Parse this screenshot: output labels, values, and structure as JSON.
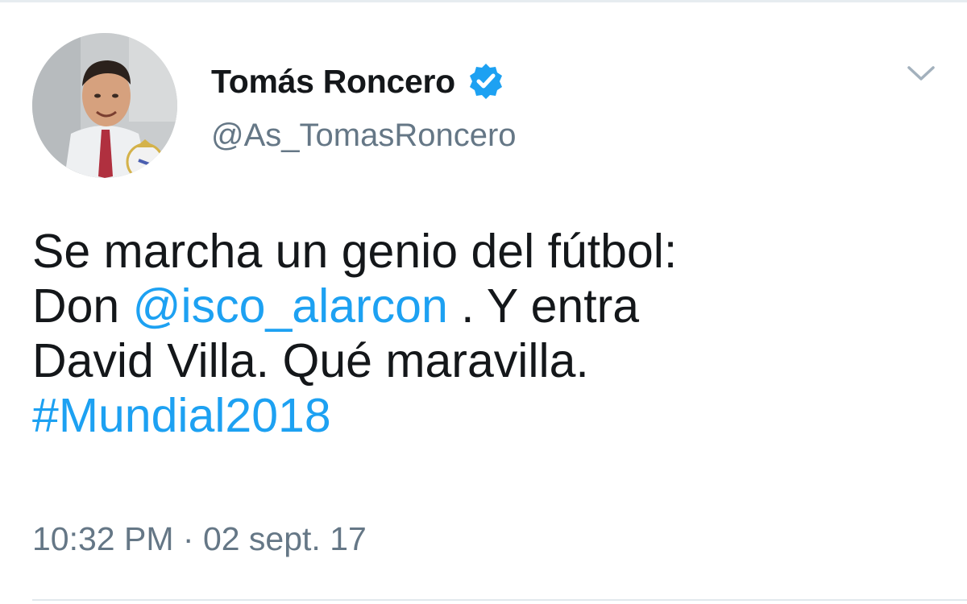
{
  "author": {
    "display_name": "Tomás Roncero",
    "handle": "@As_TomasRoncero",
    "verified": true,
    "avatar_icon": "profile-photo"
  },
  "menu": {
    "icon": "chevron-down-icon"
  },
  "tweet": {
    "line1": "Se marcha un genio del fútbol:",
    "line2_prefix": "Don ",
    "mention": "@isco_alarcon",
    "line2_suffix": " . Y entra",
    "line3": "David Villa. Qué maravilla.",
    "hashtag": "#Mundial2018"
  },
  "meta": {
    "time": "10:32 PM",
    "separator": " · ",
    "date": "02 sept. 17"
  },
  "colors": {
    "link": "#1da1f2",
    "secondary_text": "#657786",
    "primary_text": "#14171a",
    "verified_badge": "#1da1f2"
  }
}
